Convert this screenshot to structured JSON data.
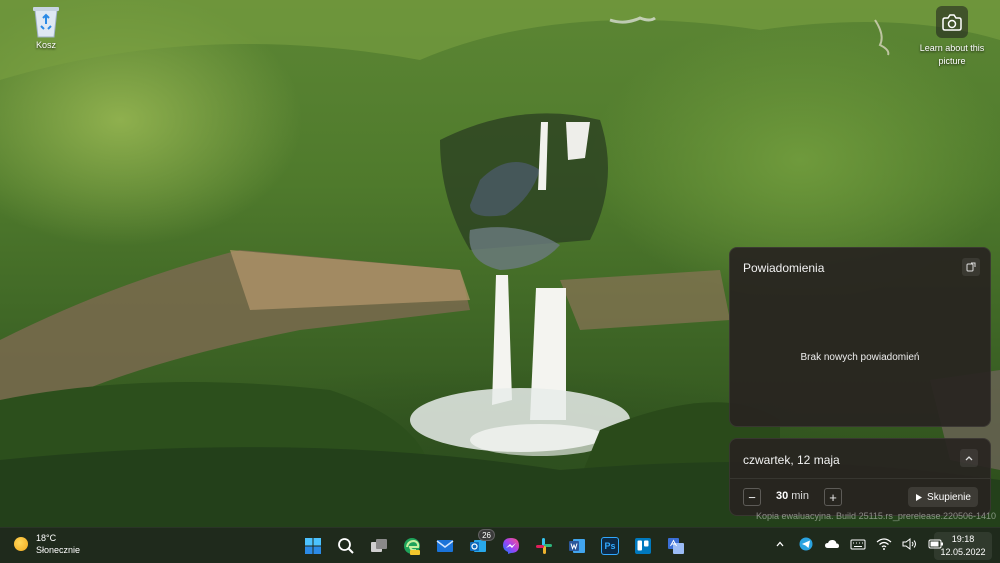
{
  "desktop": {
    "recycle_bin_label": "Kosz",
    "learn_label": "Learn about this picture"
  },
  "notifications": {
    "title": "Powiadomienia",
    "empty_text": "Brak nowych powiadomień"
  },
  "calendar": {
    "date": "czwartek, 12 maja",
    "focus_minutes": "30",
    "focus_unit": "min",
    "focus_button": "Skupienie"
  },
  "watermark": "Kopia ewaluacyjna. Build 25115.rs_prerelease.220506-1410",
  "taskbar": {
    "weather": {
      "temperature": "18°C",
      "condition": "Słonecznie"
    },
    "apps": [
      {
        "name": "start-button",
        "icon": "windows-logo",
        "color": "#2b8ae6"
      },
      {
        "name": "search-button",
        "icon": "search-icon",
        "color": "#ffffff"
      },
      {
        "name": "task-view-button",
        "icon": "task-view-icon",
        "color": "#cfcfcf"
      },
      {
        "name": "edge-canary",
        "icon": "edge-icon",
        "color": "#1fa35a",
        "label": "CAN"
      },
      {
        "name": "mail-app",
        "icon": "mail-icon",
        "color": "#1a73d9"
      },
      {
        "name": "outlook-app",
        "icon": "outlook-icon",
        "color": "#0f6cbd",
        "badge": "26"
      },
      {
        "name": "messenger-app",
        "icon": "messenger-icon",
        "color": "#a142f4"
      },
      {
        "name": "slack-app",
        "icon": "slack-icon",
        "color": "#ffffff"
      },
      {
        "name": "word-app",
        "icon": "word-icon",
        "color": "#2b579a",
        "label": "W"
      },
      {
        "name": "photoshop-app",
        "icon": "photoshop-icon",
        "color": "#0c2a46",
        "label": "Ps"
      },
      {
        "name": "trello-app",
        "icon": "trello-icon",
        "color": "#0079bf"
      },
      {
        "name": "translator-app",
        "icon": "translator-icon",
        "color": "#3b6fd6"
      }
    ],
    "clock": {
      "time": "19:18",
      "date": "12.05.2022"
    }
  },
  "colors": {
    "panel_bg": "#28241f",
    "taskbar_bg": "#1f2a1c",
    "accent": "#2b8ae6"
  }
}
